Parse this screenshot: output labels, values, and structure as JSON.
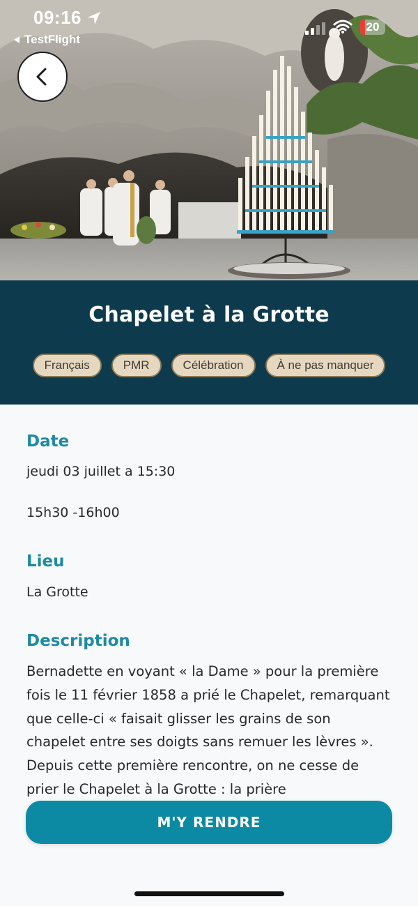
{
  "status_bar": {
    "time": "09:16",
    "back_app": "TestFlight",
    "battery": "20",
    "battery_level": 0.2,
    "battery_color": "#ea3d33"
  },
  "hero": {
    "image": "grotto-photo"
  },
  "event": {
    "title": "Chapelet à la Grotte",
    "tags": [
      "Français",
      "PMR",
      "Célébration",
      "À ne pas manquer"
    ]
  },
  "details": {
    "date_heading": "Date",
    "date_value": "jeudi 03 juillet a 15:30",
    "time_range": "15h30 -16h00",
    "place_heading": "Lieu",
    "place_value": "La Grotte",
    "description_heading": "Description",
    "description": "Bernadette en voyant « la Dame » pour la première fois le 11 février 1858 a prié le Chapelet, remarquant que celle-ci « faisait glisser les grains de son chapelet entre ses doigts sans remuer les lèvres ». Depuis cette première rencontre, on ne cesse de prier le Chapelet à la Grotte : la prière"
  },
  "cta": {
    "label": "M'Y RENDRE"
  },
  "colors": {
    "band": "#0d3a4d",
    "accent": "#1d8aa3",
    "cta": "#0d8aa3",
    "tag_bg": "#e6d8c0",
    "tag_border": "#8c7a57"
  }
}
